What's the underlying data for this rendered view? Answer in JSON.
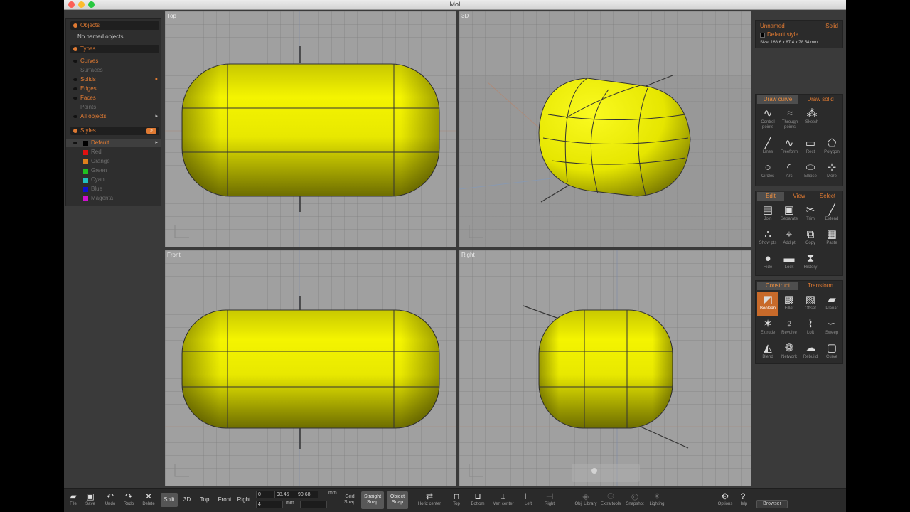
{
  "window": {
    "title": "MoI"
  },
  "left_panel": {
    "objects": {
      "label": "Objects",
      "empty": "No named objects"
    },
    "types": {
      "label": "Types",
      "items": [
        {
          "label": "Curves",
          "enabled": true
        },
        {
          "label": "Surfaces",
          "enabled": false
        },
        {
          "label": "Solids",
          "enabled": true
        },
        {
          "label": "Edges",
          "enabled": true
        },
        {
          "label": "Faces",
          "enabled": true
        },
        {
          "label": "Points",
          "enabled": false
        },
        {
          "label": "All objects",
          "enabled": true
        }
      ]
    },
    "styles": {
      "label": "Styles",
      "edit_label": "»",
      "items": [
        {
          "label": "Default",
          "color": "#000000"
        },
        {
          "label": "Red",
          "color": "#e01010"
        },
        {
          "label": "Orange",
          "color": "#e0801c"
        },
        {
          "label": "Green",
          "color": "#20c020"
        },
        {
          "label": "Cyan",
          "color": "#20c0c0"
        },
        {
          "label": "Blue",
          "color": "#1010d0"
        },
        {
          "label": "Magenta",
          "color": "#d010d0"
        }
      ]
    }
  },
  "viewports": {
    "top": "Top",
    "3d": "3D",
    "front": "Front",
    "right": "Right"
  },
  "properties": {
    "name": "Unnamed",
    "type": "Solid",
    "style": "Default style",
    "size": "Size: 168.6 x 87.4 x 78.54 mm"
  },
  "draw_tabs": [
    "Draw curve",
    "Draw solid"
  ],
  "draw_tools": [
    {
      "icon": "∿",
      "label": "Control points"
    },
    {
      "icon": "≈",
      "label": "Through points"
    },
    {
      "icon": "⁂",
      "label": "Sketch"
    },
    {
      "icon": "╱",
      "label": "Lines"
    },
    {
      "icon": "∿",
      "label": "Freeform"
    },
    {
      "icon": "▭",
      "label": "Rect"
    },
    {
      "icon": "⬠",
      "label": "Polygon"
    },
    {
      "icon": "○",
      "label": "Circles"
    },
    {
      "icon": "◜",
      "label": "Arc"
    },
    {
      "icon": "⬭",
      "label": "Ellipse"
    },
    {
      "icon": "⊹",
      "label": "More"
    }
  ],
  "edit_tabs": [
    "Edit",
    "View",
    "Select"
  ],
  "edit_tools": [
    {
      "icon": "▤",
      "label": "Join"
    },
    {
      "icon": "▣",
      "label": "Separate"
    },
    {
      "icon": "✂",
      "label": "Trim"
    },
    {
      "icon": "╱",
      "label": "Extend"
    },
    {
      "icon": "∴",
      "label": "Show pts"
    },
    {
      "icon": "⌖",
      "label": "Add pt"
    },
    {
      "icon": "⧉",
      "label": "Copy"
    },
    {
      "icon": "▦",
      "label": "Paste"
    },
    {
      "icon": "●",
      "label": "Hide"
    },
    {
      "icon": "▬",
      "label": "Lock"
    },
    {
      "icon": "⧗",
      "label": "History"
    }
  ],
  "construct_tabs": [
    "Construct",
    "Transform"
  ],
  "construct_tools": [
    {
      "icon": "◩",
      "label": "Boolean",
      "highlighted": true
    },
    {
      "icon": "▩",
      "label": "Fillet"
    },
    {
      "icon": "▧",
      "label": "Offset"
    },
    {
      "icon": "▰",
      "label": "Planar"
    },
    {
      "icon": "✶",
      "label": "Extrude"
    },
    {
      "icon": "♀",
      "label": "Revolve"
    },
    {
      "icon": "⌇",
      "label": "Loft"
    },
    {
      "icon": "∽",
      "label": "Sweep"
    },
    {
      "icon": "◭",
      "label": "Blend"
    },
    {
      "icon": "❁",
      "label": "Network"
    },
    {
      "icon": "☁",
      "label": "Rebuild"
    },
    {
      "icon": "▢",
      "label": "Curve"
    }
  ],
  "bottom": {
    "file": "File",
    "save": "Save",
    "undo": "Undo",
    "redo": "Redo",
    "delete": "Delete",
    "view_buttons": [
      "Split",
      "3D",
      "Top",
      "Front",
      "Right"
    ],
    "active_view": "Split",
    "coord_x": "0",
    "coord_y": "98.45",
    "coord_z": "90.68",
    "unit": "mm",
    "coord_row2_a": "4",
    "coord_row2_unit": "mm",
    "snaps": [
      "Grid Snap",
      "Straight Snap",
      "Object Snap"
    ],
    "view_tools": [
      {
        "icon": "⇄",
        "label": "Horiz center"
      },
      {
        "icon": "⊓",
        "label": "Top"
      },
      {
        "icon": "⊔",
        "label": "Bottom"
      },
      {
        "icon": "⌶",
        "label": "Vert center"
      },
      {
        "icon": "⊢",
        "label": "Left"
      },
      {
        "icon": "⊣",
        "label": "Right"
      }
    ],
    "extra_tools": [
      {
        "icon": "◈",
        "label": "Obj. Library"
      },
      {
        "icon": "⚇",
        "label": "Extra tools"
      },
      {
        "icon": "◎",
        "label": "Snapshot"
      },
      {
        "icon": "☀",
        "label": "Lighting"
      }
    ],
    "options": "Options",
    "help": "Help",
    "browser": "Browser"
  }
}
